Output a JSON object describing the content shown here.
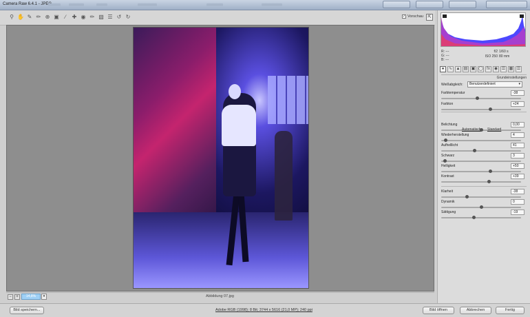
{
  "window": {
    "title": "Camera Raw 6.4.1  -  JPEG"
  },
  "toolbar": {
    "tools": [
      "zoom-icon",
      "hand-icon",
      "eyedropper-icon",
      "color-sampler-icon",
      "target-adjust-icon",
      "crop-icon",
      "straighten-icon",
      "spot-removal-icon",
      "red-eye-icon",
      "adjustment-brush-icon",
      "graduated-filter-icon",
      "preferences-icon",
      "rotate-ccw-icon",
      "rotate-cw-icon"
    ],
    "preview_label": "Vorschau",
    "preview_checked": true
  },
  "canvas": {
    "zoom": "14,8%",
    "filename": "Abbildung 07.jpg"
  },
  "panel": {
    "info": {
      "r": "R:  ---",
      "g": "G:  ---",
      "b": "B:  ---",
      "aperture": "f/2",
      "shutter": "1/60 s",
      "iso": "ISO 250",
      "focal": "80 mm"
    },
    "section_title": "Grundeinstellungen",
    "wb_label": "Weißabgleich:",
    "wb_value": "Benutzerdefiniert",
    "sliders": [
      {
        "label": "Farbtemperatur",
        "value": "-38",
        "fraction": 0.45
      },
      {
        "label": "Farbton",
        "value": "+24",
        "fraction": 0.62
      },
      {
        "label": "Belichtung",
        "value": "0,00",
        "fraction": 0.5
      },
      {
        "label": "Wiederherstellung",
        "value": "4",
        "fraction": 0.04
      },
      {
        "label": "Aufhelllicht",
        "value": "41",
        "fraction": 0.41
      },
      {
        "label": "Schwarz",
        "value": "3",
        "fraction": 0.03
      },
      {
        "label": "Helligkeit",
        "value": "+50",
        "fraction": 0.62
      },
      {
        "label": "Kontrast",
        "value": "+39",
        "fraction": 0.6
      },
      {
        "label": "Klarheit",
        "value": "-38",
        "fraction": 0.31
      },
      {
        "label": "Dynamik",
        "value": "0",
        "fraction": 0.5
      },
      {
        "label": "Sättigung",
        "value": "-19",
        "fraction": 0.4
      }
    ],
    "auto_label": "Automatisch",
    "default_label": "Standard"
  },
  "bottom": {
    "save_label": "Bild speichern...",
    "meta": "Adobe RGB (1998); 8 Bit; 3744 x 5616 (21,0 MP); 240 ppi",
    "open_label": "Bild öffnen",
    "cancel_label": "Abbrechen",
    "done_label": "Fertig"
  },
  "colors": {
    "zoom_accent": "#9fd0f5",
    "histogram_blue": "#3a34ff",
    "histogram_magenta": "#c43cbf"
  }
}
